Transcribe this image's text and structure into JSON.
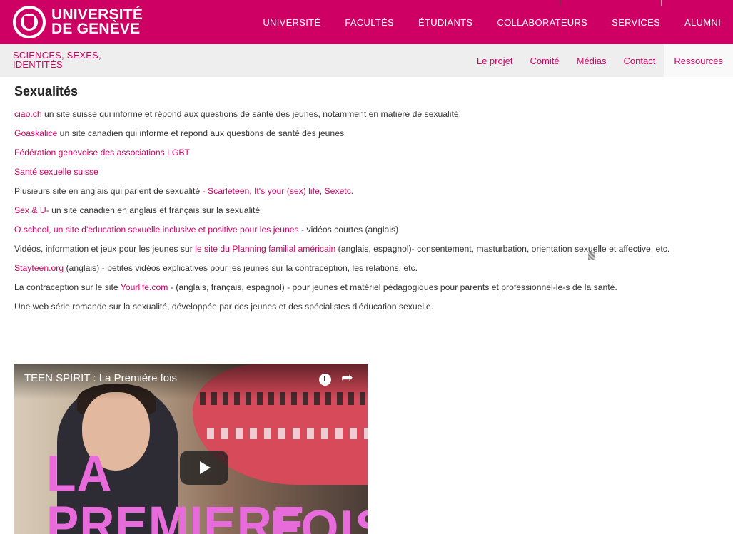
{
  "header": {
    "logo_line1": "UNIVERSITÉ",
    "logo_line2": "DE GENÈVE",
    "nav": [
      "UNIVERSITÉ",
      "FACULTÉS",
      "ÉTUDIANTS",
      "COLLABORATEURS",
      "SERVICES",
      "ALUMNI"
    ]
  },
  "subheader": {
    "site_name_line1": "SCIENCES, SEXES,",
    "site_name_line2": "IDENTITÉS",
    "nav": [
      "Le projet",
      "Comité",
      "Médias",
      "Contact",
      "Ressources"
    ],
    "active": "Ressources"
  },
  "main": {
    "title": "Sexualités",
    "p1": {
      "link": "ciao.ch",
      "text": " un site suisse qui informe et répond aux questions de santé des jeunes, notamment en matière de sexualité."
    },
    "p2": {
      "link": "Goaskalice",
      "text": " un site canadien qui informe et répond aux questions de santé des jeunes"
    },
    "p3": {
      "link": "Fédération genevoise des associations LGBT"
    },
    "p4": {
      "link": "Santé sexuelle suisse"
    },
    "p5": {
      "text": "Plusieurs site en anglais qui parlent de sexualité ",
      "link": "- Scarleteen, It's your (sex) life, Sexetc."
    },
    "p6": {
      "link": "Sex & U-",
      "text": " un site canadien en anglais et français sur la sexualité"
    },
    "p7": {
      "link": "O.school, un site d'éducation sexuelle inclusive et positive pour les jeunes",
      "text": " - vidéos courtes (anglais)"
    },
    "p8": {
      "text_before": "Vidéos, information et jeux pour les jeunes sur ",
      "link": "le site du Planning familial américain",
      "text_after": " (anglais, espagnol)- consentement, masturbation, orientation sexuelle et affective, etc."
    },
    "p9": {
      "link": "Stayteen.org",
      "text": " (anglais) - petites vidéos explicatives pour les jeunes sur la contraception, les relations, etc."
    },
    "p10": {
      "text_before": "La contraception sur le site ",
      "link": "Yourlife.com",
      "text_after": " - (anglais, français, espagnol) - pour jeunes et matériel pédagogiques pour parents et professionnel-le-s de la santé."
    },
    "p11": {
      "text": "Une web série romande sur la sexualité, développée par des jeunes et des spécialistes d'éducation sexuelle."
    }
  },
  "video": {
    "title": "TEEN SPIRIT : La Première fois",
    "overlay_line1": "LA PREMIERE",
    "overlay_line2": "FOIS",
    "icons": [
      "clock-icon",
      "share-icon",
      "play-icon"
    ]
  },
  "colors": {
    "brand": "#cf0063",
    "subbar": "#eeeeee",
    "overlay_text": "#e86bdc"
  }
}
